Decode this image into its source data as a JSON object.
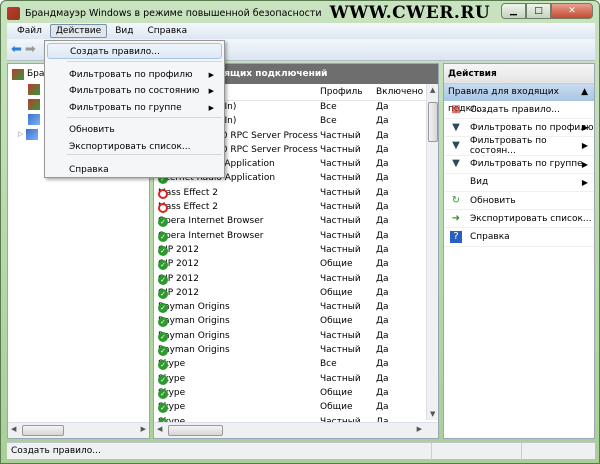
{
  "window": {
    "title": "Брандмауэр Windows в режиме повышенной безопасности",
    "watermark": "WWW.CWER.RU",
    "minimize": "▁",
    "maximize": "□",
    "close": "✕"
  },
  "menubar": [
    "Файл",
    "Действие",
    "Вид",
    "Справка"
  ],
  "dropdown": {
    "items": [
      {
        "label": "Создать правило...",
        "highlighted": true
      },
      {
        "label": "Фильтровать по профилю",
        "submenu": true
      },
      {
        "label": "Фильтровать по состоянию",
        "submenu": true
      },
      {
        "label": "Фильтровать по группе",
        "submenu": true
      },
      {
        "label": "Обновить"
      },
      {
        "label": "Экспортировать список..."
      },
      {
        "label": "Справка"
      }
    ],
    "arrow": "▶"
  },
  "left_tree": {
    "root": "Бра"
  },
  "center": {
    "header": "ходящих подключений",
    "columns": [
      "Профиль",
      "Включено"
    ],
    "rows": [
      {
        "name": "P-In)",
        "profile": "Все",
        "enabled": "Да",
        "status": "allow",
        "hidden": true
      },
      {
        "name": "P-In)",
        "profile": "Все",
        "enabled": "Да",
        "status": "allow",
        "hidden": true
      },
      {
        "name": "00 RPC Server Process",
        "profile": "Частный",
        "enabled": "Да",
        "status": "allow",
        "hidden": true
      },
      {
        "name": "00 RPC Server Process",
        "profile": "Частный",
        "enabled": "Да",
        "status": "allow",
        "hidden": true
      },
      {
        "name": "o Application",
        "profile": "Частный",
        "enabled": "Да",
        "status": "allow",
        "hidden": true
      },
      {
        "name": "Internet Radio Application",
        "profile": "Частный",
        "enabled": "Да",
        "status": "allow"
      },
      {
        "name": "Mass Effect 2",
        "profile": "Частный",
        "enabled": "Да",
        "status": "block"
      },
      {
        "name": "Mass Effect 2",
        "profile": "Частный",
        "enabled": "Да",
        "status": "block"
      },
      {
        "name": "Opera Internet Browser",
        "profile": "Частный",
        "enabled": "Да",
        "status": "allow"
      },
      {
        "name": "Opera Internet Browser",
        "profile": "Частный",
        "enabled": "Да",
        "status": "allow"
      },
      {
        "name": "QIP 2012",
        "profile": "Частный",
        "enabled": "Да",
        "status": "allow"
      },
      {
        "name": "QIP 2012",
        "profile": "Общие",
        "enabled": "Да",
        "status": "allow"
      },
      {
        "name": "QIP 2012",
        "profile": "Частный",
        "enabled": "Да",
        "status": "allow"
      },
      {
        "name": "QIP 2012",
        "profile": "Общие",
        "enabled": "Да",
        "status": "allow"
      },
      {
        "name": "Rayman Origins",
        "profile": "Частный",
        "enabled": "Да",
        "status": "allow"
      },
      {
        "name": "Rayman Origins",
        "profile": "Общие",
        "enabled": "Да",
        "status": "allow"
      },
      {
        "name": "Rayman Origins",
        "profile": "Частный",
        "enabled": "Да",
        "status": "allow"
      },
      {
        "name": "Rayman Origins",
        "profile": "Частный",
        "enabled": "Да",
        "status": "allow"
      },
      {
        "name": "Skype",
        "profile": "Все",
        "enabled": "Да",
        "status": "allow"
      },
      {
        "name": "Skype",
        "profile": "Частный",
        "enabled": "Да",
        "status": "allow"
      },
      {
        "name": "Skype",
        "profile": "Общие",
        "enabled": "Да",
        "status": "allow"
      },
      {
        "name": "Skype",
        "profile": "Общие",
        "enabled": "Да",
        "status": "allow"
      },
      {
        "name": "Skype",
        "profile": "Частный",
        "enabled": "Да",
        "status": "allow"
      }
    ]
  },
  "actions": {
    "title": "Действия",
    "section": "Правила для входящих подкл...",
    "items": [
      {
        "label": "Создать правило...",
        "icon": "new-rule-icon"
      },
      {
        "label": "Фильтровать по профилю",
        "icon": "filter-icon",
        "submenu": true
      },
      {
        "label": "Фильтровать по состоян...",
        "icon": "filter-icon",
        "submenu": true
      },
      {
        "label": "Фильтровать по группе",
        "icon": "filter-icon",
        "submenu": true
      },
      {
        "label": "Вид",
        "icon": "",
        "submenu": true
      },
      {
        "label": "Обновить",
        "icon": "refresh-icon"
      },
      {
        "label": "Экспортировать список...",
        "icon": "export-icon"
      },
      {
        "label": "Справка",
        "icon": "help-icon"
      }
    ]
  },
  "status": {
    "text": "Создать правило..."
  }
}
